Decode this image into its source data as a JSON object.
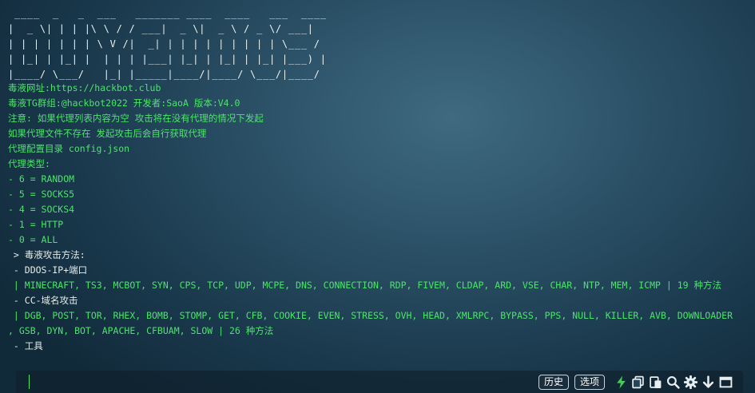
{
  "terminal": {
    "banner": " ____  _   _  ___   _______ ____  ____   ___  ____\n|  _ \\| | | |\\ \\ / / ___|  _ \\|  _ \\ / _ \\/ ___|\n| | | | | | | \\ V /|  _| | | | | | | | | | \\___ /\n| |_| | |_| |  | | | |___| |_| | |_| | |_| |___) |\n|____/ \\___/   |_| |_____|____/|____/ \\___/|____/",
    "lines": [
      "毒液网址:https://hackbot.club",
      "毒液TG群组:@hackbot2022 开发者:SaoA 版本:V4.0",
      "注意: 如果代理列表内容为空 攻击将在没有代理的情况下发起",
      "如果代理文件不存在 发起攻击后会自行获取代理",
      "代理配置目录 config.json",
      "代理类型:",
      "- 6 = RANDOM",
      "- 5 = SOCKS5",
      "- 4 = SOCKS4",
      "- 1 = HTTP",
      "- 0 = ALL",
      " > 毒液攻击方法:",
      " - DDOS-IP+端口",
      " | MINECRAFT, TS3, MCBOT, SYN, CPS, TCP, UDP, MCPE, DNS, CONNECTION, RDP, FIVEM, CLDAP, ARD, VSE, CHAR, NTP, MEM, ICMP | 19 种方法",
      " - CC-域名攻击",
      " | DGB, POST, TOR, RHEX, BOMB, STOMP, GET, CFB, COOKIE, EVEN, STRESS, OVH, HEAD, XMLRPC, BYPASS, PPS, NULL, KILLER, AVB, DOWNLOADER",
      ", GSB, DYN, BOT, APACHE, CFBUAM, SLOW | 26 种方法",
      " - 工具"
    ]
  },
  "input_bar": {
    "history_label": "历史",
    "options_label": "选项"
  },
  "icons": {
    "bolt": "lightning-icon",
    "copy": "copy-icon",
    "paste": "paste-icon",
    "search": "search-icon",
    "settings": "gear-icon",
    "download": "arrow-down-icon",
    "window": "window-icon"
  },
  "colors": {
    "text_green": "#4ce46a",
    "banner_white": "#eef2ef",
    "bolt_green": "#3fd24f"
  }
}
